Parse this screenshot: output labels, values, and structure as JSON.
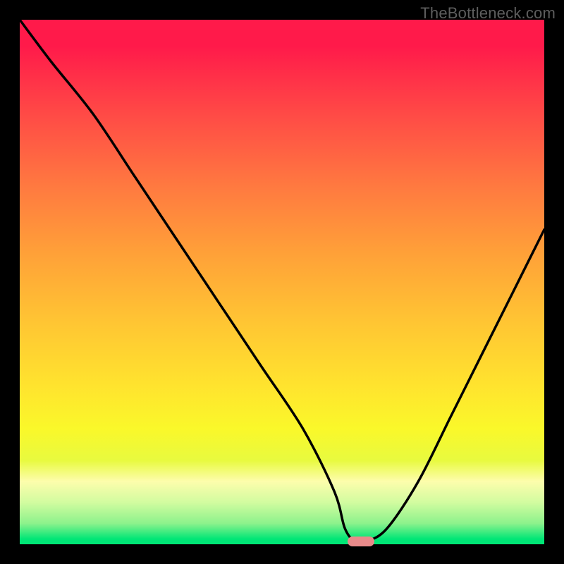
{
  "watermark": "TheBottleneck.com",
  "colors": {
    "background": "#000000",
    "marker": "#e88a8a",
    "curve": "#000000",
    "gradient_top": "#ff1a4a",
    "gradient_bottom": "#00e676"
  },
  "chart_data": {
    "type": "line",
    "title": "",
    "xlabel": "",
    "ylabel": "",
    "xlim": [
      0,
      100
    ],
    "ylim": [
      0,
      100
    ],
    "grid": false,
    "legend": false,
    "series": [
      {
        "name": "bottleneck-curve",
        "x": [
          0,
          6,
          14,
          22,
          30,
          38,
          46,
          54,
          60,
          62,
          64,
          66,
          70,
          76,
          82,
          88,
          94,
          100
        ],
        "y": [
          100,
          92,
          82,
          70,
          58,
          46,
          34,
          22,
          10,
          3,
          0.5,
          0.5,
          3,
          12,
          24,
          36,
          48,
          60
        ]
      }
    ],
    "marker": {
      "x": 65,
      "y": 0.5,
      "shape": "pill"
    }
  }
}
